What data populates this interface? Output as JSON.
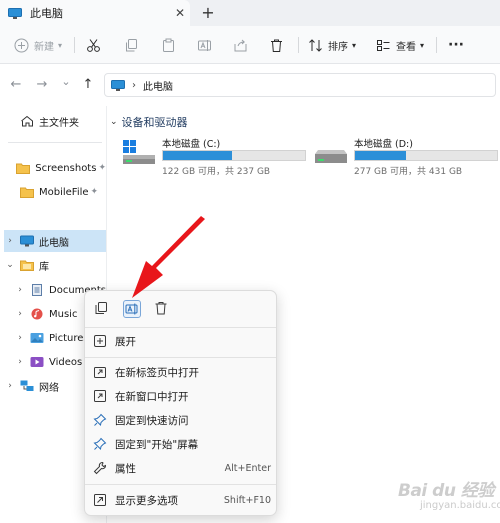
{
  "window": {
    "tab_title": "此电脑",
    "tab_close": "✕",
    "new_tab": "+"
  },
  "toolbar": {
    "new_label": "新建",
    "sort_label": "排序",
    "view_label": "查看",
    "more_label": "···"
  },
  "nav": {
    "back": "←",
    "forward": "→",
    "history": "⌄",
    "up": "↑"
  },
  "address": {
    "crumb_sep": "›",
    "crumb": "此电脑"
  },
  "sidebar": {
    "items": [
      {
        "label": "主文件夹"
      },
      {
        "label": "Screenshots"
      },
      {
        "label": "MobileFile"
      },
      {
        "label": "此电脑"
      },
      {
        "label": "库"
      },
      {
        "label": "Documents"
      },
      {
        "label": "Music"
      },
      {
        "label": "Pictures"
      },
      {
        "label": "Videos"
      },
      {
        "label": "网络"
      }
    ],
    "pin_glyph": "📌"
  },
  "content": {
    "section_title": "设备和驱动器",
    "drives": [
      {
        "name": "本地磁盘 (C:)",
        "free": "122 GB 可用，共 237 GB",
        "used_fraction": 0.485
      },
      {
        "name": "本地磁盘 (D:)",
        "free": "277 GB 可用，共 431 GB",
        "used_fraction": 0.357
      }
    ]
  },
  "context_menu": {
    "items": [
      {
        "label": "展开",
        "shortcut": ""
      },
      {
        "label": "在新标签页中打开",
        "shortcut": ""
      },
      {
        "label": "在新窗口中打开",
        "shortcut": ""
      },
      {
        "label": "固定到快速访问",
        "shortcut": ""
      },
      {
        "label": "固定到\"开始\"屏幕",
        "shortcut": ""
      },
      {
        "label": "属性",
        "shortcut": "Alt+Enter"
      },
      {
        "label": "显示更多选项",
        "shortcut": "Shift+F10"
      }
    ]
  },
  "watermark": {
    "main": "Bai du 经验",
    "sub": "jingyan.baidu.com"
  },
  "colors": {
    "accent": "#2c8fd8",
    "selection": "#cce4f7",
    "arrow": "#e8161b"
  }
}
